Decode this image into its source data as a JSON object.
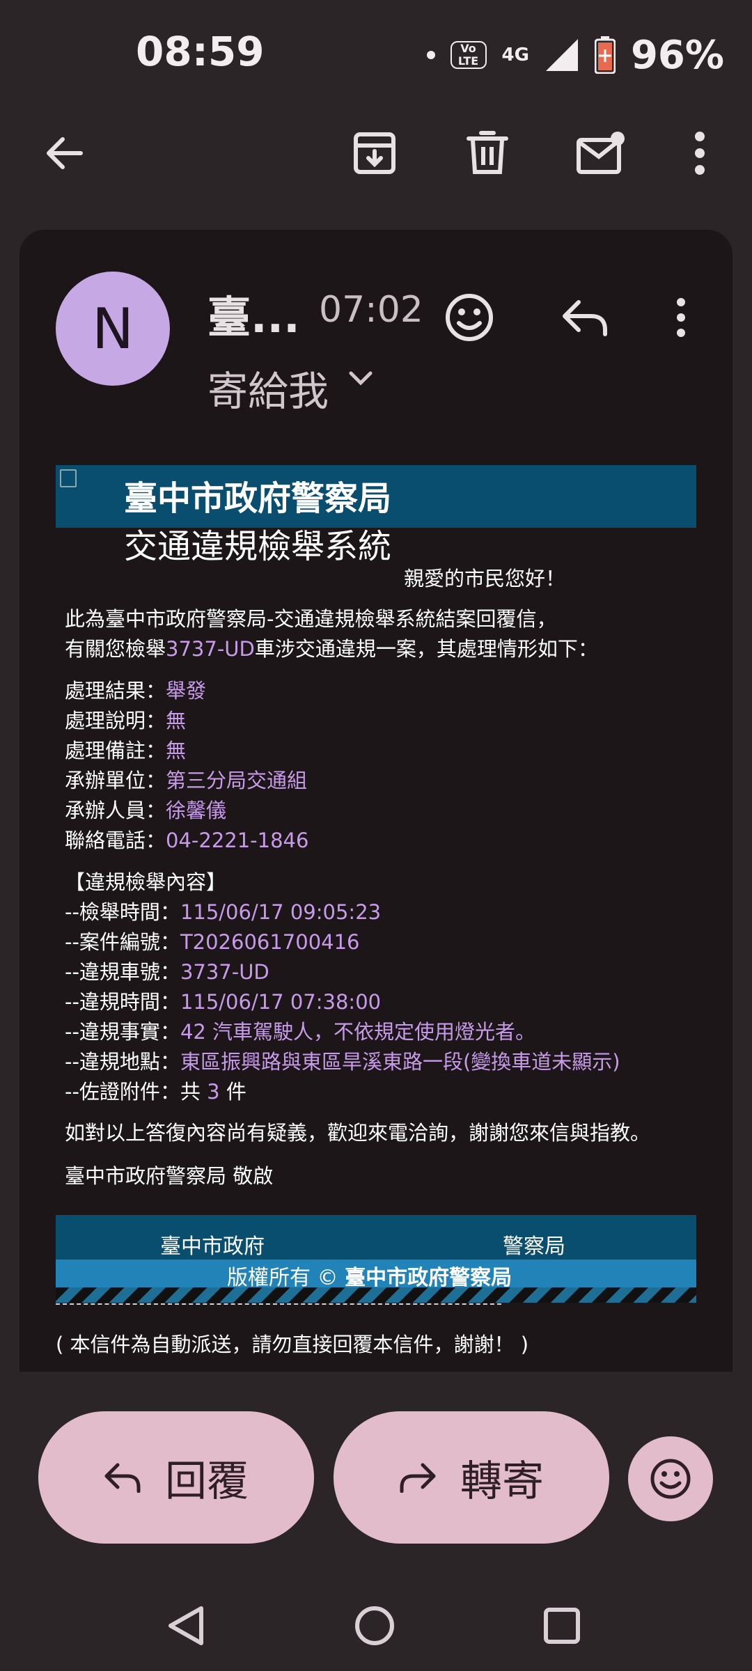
{
  "status_bar": {
    "time": "08:59",
    "volte": "Vo LTE",
    "network": "4G",
    "battery": "96%"
  },
  "email": {
    "avatar_letter": "N",
    "sender": "臺...",
    "time": "07:02",
    "recipient": "寄給我",
    "banner": {
      "title": "臺中市政府警察局",
      "subtitle": "交通違規檢舉系統"
    },
    "greeting": "親愛的市民您好！",
    "intro_line1": "此為臺中市政府警察局-交通違規檢舉系統結案回覆信，",
    "intro_line2_pre": "有關您檢舉",
    "plate": "3737-UD",
    "intro_line2_post": "車涉交通違規一案，其處理情形如下：",
    "fields": [
      {
        "label": "處理結果：",
        "value": "舉發"
      },
      {
        "label": "處理說明：",
        "value": "無"
      },
      {
        "label": "處理備註：",
        "value": "無"
      },
      {
        "label": "承辦單位：",
        "value": "第三分局交通組"
      },
      {
        "label": "承辦人員：",
        "value": "徐馨儀"
      },
      {
        "label": "聯絡電話：",
        "value": "04-2221-1846"
      }
    ],
    "section_title": "【違規檢舉內容】",
    "details": [
      {
        "label": "--檢舉時間：",
        "value": "115/06/17 09:05:23"
      },
      {
        "label": "--案件編號：",
        "value": "T2026061700416"
      },
      {
        "label": "--違規車號：",
        "value": "3737-UD"
      },
      {
        "label": "--違規時間：",
        "value": "115/06/17 07:38:00"
      },
      {
        "label": "--違規事實：",
        "value": "42 汽車駕駛人，不依規定使用燈光者。"
      },
      {
        "label": "--違規地點：",
        "value": "東區振興路與東區旱溪東路一段(變換車道未顯示)"
      }
    ],
    "attachments": {
      "label": "--佐證附件：共 ",
      "count": "3",
      "suffix": " 件"
    },
    "closing": "如對以上答復內容尚有疑義，歡迎來電洽詢，謝謝您來信與指教。",
    "signature": "臺中市政府警察局 敬啟",
    "footer": {
      "left": "臺中市政府",
      "right": "警察局",
      "copyright_pre": "版權所有 © ",
      "copyright_org": "臺中市政府警察局"
    },
    "auto_note": "( 本信件為自動派送，請勿直接回覆本信件，謝謝！ )"
  },
  "actions": {
    "reply": "回覆",
    "forward": "轉寄"
  },
  "colors": {
    "background": "#2b2528",
    "card": "#1c1618",
    "accent_pill": "#e2bccb",
    "link": "#c89bea",
    "banner": "#0a4e6f"
  }
}
